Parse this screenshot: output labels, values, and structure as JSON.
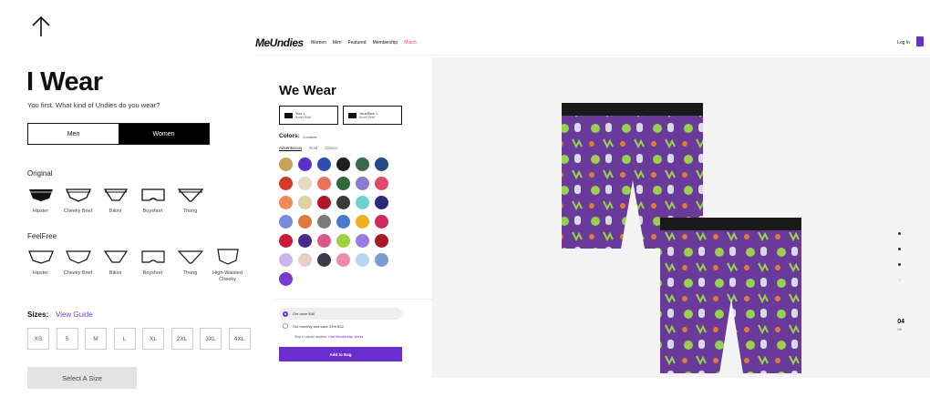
{
  "left": {
    "title": "I Wear",
    "subtitle": "You first. What kind of Undies do you wear?",
    "gender_tabs": [
      "Men",
      "Women"
    ],
    "active_gender": "Women",
    "original_label": "Original",
    "original_styles": [
      "Hipster",
      "Cheeky Brief",
      "Bikini",
      "Boyshort",
      "Thong"
    ],
    "feelfree_label": "FeelFree",
    "feelfree_styles": [
      "Hipster",
      "Cheeky Brief",
      "Bikini",
      "Boyshort",
      "Thong",
      "High-Waisted Cheeky"
    ],
    "sizes_label": "Sizes:",
    "view_guide": "View Guide",
    "sizes": [
      "XS",
      "S",
      "M",
      "L",
      "XL",
      "2XL",
      "3XL",
      "4XL"
    ],
    "select_button": "Select A Size"
  },
  "page": {
    "logo": "MeUndies",
    "nav": [
      "Women",
      "Men",
      "Featured",
      "Membership"
    ],
    "nav_pink": "Match",
    "login": "Log In",
    "we_wear": "We Wear",
    "box1_title": "You: L",
    "box1_sub": "Boxer Brief",
    "box2_title": "Your Boo: L",
    "box2_sub": "Boxer Brief",
    "colors_label": "Colors:",
    "colors_value": "Zombies",
    "color_tabs": [
      "Adventurous",
      "Bold",
      "Classic"
    ],
    "option1": "Get once $46",
    "option2": "Get monthly and save 33% $32",
    "skip_text": "Skip or cancel anytime.",
    "skip_link": "How Membership Works",
    "add_button": "Add to Bag",
    "page_num": "04",
    "page_den": "05",
    "accent": "#6a2ecf",
    "pink": "#ff4d6d"
  }
}
